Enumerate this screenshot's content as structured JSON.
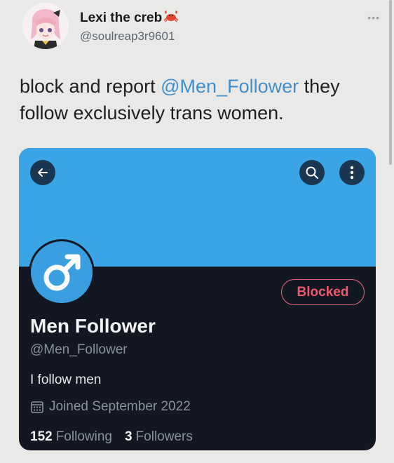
{
  "tweet": {
    "author": {
      "display_name": "Lexi the creb",
      "name_emoji": "crab-emoji",
      "handle": "@soulreap3r9601"
    },
    "more_icon": "more-dots-icon",
    "text_before": "block and report ",
    "mention": "@Men_Follower",
    "text_after": " they follow exclusively trans women."
  },
  "card": {
    "banner_color": "#3aa5e6",
    "back_icon": "back-arrow-icon",
    "search_icon": "search-icon",
    "menu_icon": "vertical-dots-icon",
    "profile_icon": "male-symbol-icon",
    "blocked_label": "Blocked",
    "name": "Men Follower",
    "handle": "@Men_Follower",
    "bio": "I follow men",
    "joined_icon": "calendar-icon",
    "joined": "Joined September 2022",
    "following_count": "152",
    "following_label": "Following",
    "followers_count": "3",
    "followers_label": "Followers"
  },
  "colors": {
    "mention": "#3f8fcf",
    "card_background": "#131722",
    "blocked": "#ec5a70"
  }
}
